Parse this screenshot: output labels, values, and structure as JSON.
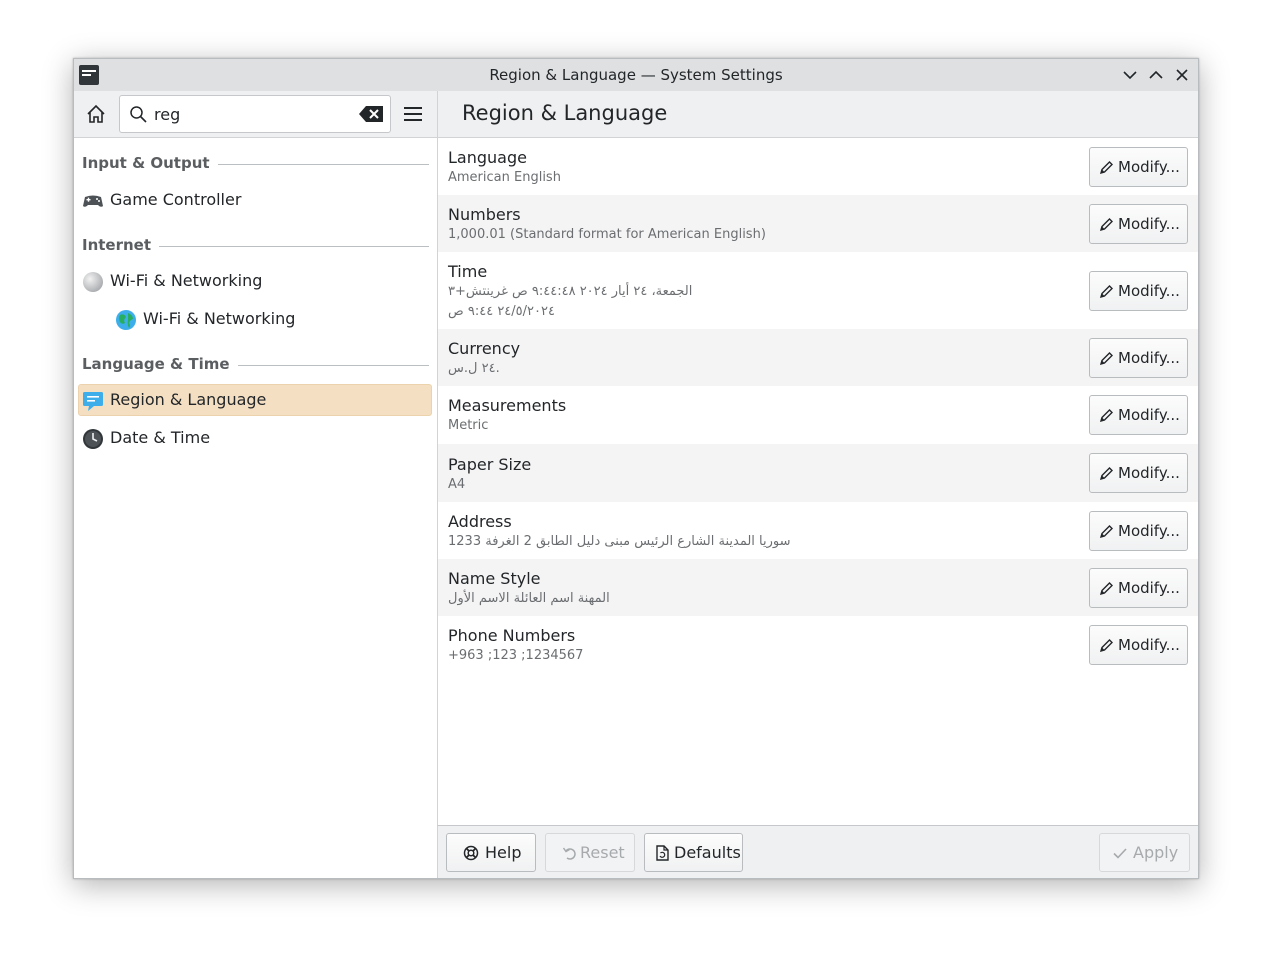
{
  "window": {
    "title": "Region & Language — System Settings",
    "titlebar_icons": [
      "app-icon",
      "minimize-icon",
      "maximize-icon",
      "close-icon"
    ]
  },
  "toolbar": {
    "search_value": "reg",
    "page_title": "Region & Language",
    "icons": [
      "home-icon",
      "search-icon",
      "clear-text-icon",
      "hamburger-menu-icon"
    ]
  },
  "sidebar": {
    "categories": [
      {
        "label": "Input & Output",
        "items": [
          {
            "label": "Game Controller",
            "icon": "gamepad-icon",
            "indent": false,
            "selected": false
          }
        ]
      },
      {
        "label": "Internet",
        "items": [
          {
            "label": "Wi-Fi & Networking",
            "icon": "network-globe-icon",
            "indent": false,
            "selected": false
          },
          {
            "label": "Wi-Fi & Networking",
            "icon": "earth-globe-icon",
            "indent": true,
            "selected": false
          }
        ]
      },
      {
        "label": "Language & Time",
        "items": [
          {
            "label": "Region & Language",
            "icon": "region-language-icon",
            "indent": false,
            "selected": true
          },
          {
            "label": "Date & Time",
            "icon": "clock-icon",
            "indent": false,
            "selected": false
          }
        ]
      }
    ]
  },
  "settings": {
    "modify_label": "Modify...",
    "rows": [
      {
        "title": "Language",
        "lines": [
          "American English"
        ]
      },
      {
        "title": "Numbers",
        "lines": [
          "1,000.01 (Standard format for American English)"
        ]
      },
      {
        "title": "Time",
        "lines": [
          "الجمعة، ٢٤ أيار ٢٠٢٤ ٩:٤٤:٤٨ ص غرينتش+٣",
          "٢٤/٥/٢٠٢٤ ٩:٤٤ ص"
        ]
      },
      {
        "title": "Currency",
        "lines": [
          "٢٤ ل.س."
        ]
      },
      {
        "title": "Measurements",
        "lines": [
          "Metric"
        ]
      },
      {
        "title": "Paper Size",
        "lines": [
          "A4"
        ]
      },
      {
        "title": "Address",
        "lines": [
          "123سوريا المدينة الشارع الرئيس مبنى دليل الطابق 2 الغرفة 3"
        ]
      },
      {
        "title": "Name Style",
        "lines": [
          "المهنة  اسم العائلة  الاسم الأول"
        ]
      },
      {
        "title": "Phone Numbers",
        "lines": [
          "+963 ;123 ;1234567"
        ]
      }
    ]
  },
  "footer": {
    "help_label": "Help",
    "reset_label": "Reset",
    "defaults_label": "Defaults",
    "apply_label": "Apply"
  },
  "colors": {
    "selection_bg": "#f4dfc3",
    "accent_blue": "#3daee9",
    "text": "#232629",
    "subtext": "#6b6e71"
  }
}
